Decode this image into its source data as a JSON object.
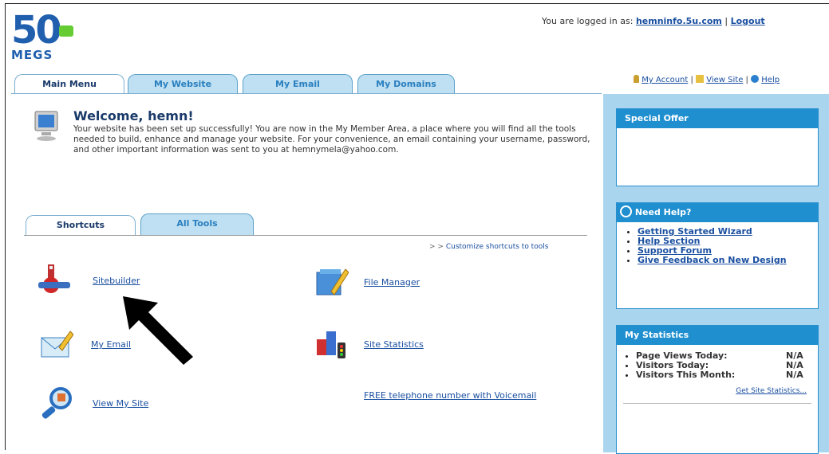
{
  "brand": {
    "number": "50",
    "name": "MEGS"
  },
  "userbar": {
    "prefix": "You are logged in as:",
    "user": "hemninfo.5u.com",
    "sep": "|",
    "logout": "Logout"
  },
  "account_links": {
    "my_account": "My Account",
    "sep1": "|",
    "view_site": "View Site",
    "sep2": "|",
    "help": "Help"
  },
  "tabs": [
    {
      "label": "Main Menu",
      "active": true
    },
    {
      "label": "My Website",
      "active": false
    },
    {
      "label": "My Email",
      "active": false
    },
    {
      "label": "My Domains",
      "active": false
    }
  ],
  "welcome": {
    "title": "Welcome, hemn!",
    "body": "Your website has been set up successfully! You are now in the My Member Area, a place where you will find all the tools needed to build, enhance and manage your website. For your convenience, an email containing your username, password, and other important information was sent to you at hemnymela@yahoo.com."
  },
  "subtabs": [
    {
      "label": "Shortcuts",
      "active": true
    },
    {
      "label": "All Tools",
      "active": false
    }
  ],
  "customize": {
    "prefix": "> >",
    "link": "Customize shortcuts to tools"
  },
  "shortcuts": {
    "sitebuilder": "Sitebuilder",
    "file_manager": "File Manager",
    "my_email": "My Email",
    "site_statistics": "Site Statistics",
    "view_my_site": "View My Site",
    "free_phone": "FREE telephone number with Voicemail"
  },
  "special_offer": {
    "title": "Special Offer"
  },
  "need_help": {
    "title": "Need Help?",
    "items": [
      "Getting Started Wizard",
      "Help Section",
      "Support Forum",
      "Give Feedback on New Design"
    ]
  },
  "my_statistics": {
    "title": "My Statistics",
    "rows": [
      {
        "label": "Page Views Today:",
        "value": "N/A"
      },
      {
        "label": "Visitors Today:",
        "value": "N/A"
      },
      {
        "label": "Visitors This Month:",
        "value": "N/A"
      }
    ],
    "link": "Get Site Statistics..."
  },
  "colors": {
    "accent": "#1f8fd0",
    "sidebar": "#a9d6ee",
    "brand": "#1f5fae",
    "brand_dot": "#66cc33"
  }
}
